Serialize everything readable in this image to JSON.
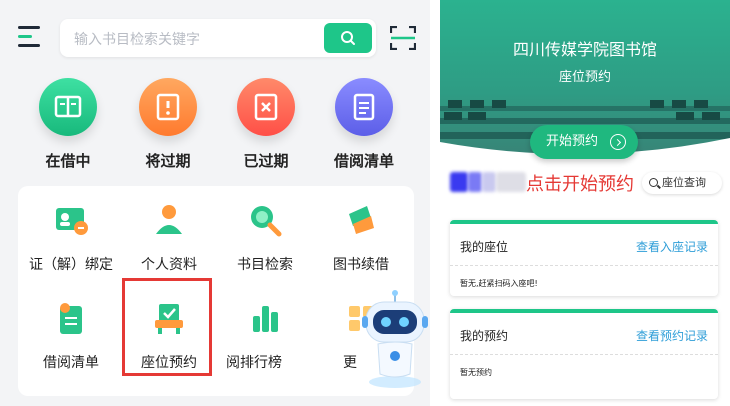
{
  "left": {
    "search": {
      "placeholder": "输入书目检索关键字"
    },
    "quick_actions": [
      {
        "label": "在借中",
        "icon": "book-icon",
        "color": "#1ec689"
      },
      {
        "label": "将过期",
        "icon": "clock-book-icon",
        "color": "#ff8a3d"
      },
      {
        "label": "已过期",
        "icon": "expired-book-icon",
        "color": "#ff5a4f"
      },
      {
        "label": "借阅清单",
        "icon": "list-icon",
        "color": "#6a6cf0"
      }
    ],
    "grid_items": [
      {
        "label": "证（解）绑定",
        "icon": "id-card-icon"
      },
      {
        "label": "个人资料",
        "icon": "person-icon"
      },
      {
        "label": "书目检索",
        "icon": "search-icon"
      },
      {
        "label": "图书续借",
        "icon": "renew-icon"
      },
      {
        "label": "借阅清单",
        "icon": "reading-list-icon"
      },
      {
        "label": "座位预约",
        "icon": "seat-icon"
      },
      {
        "label": "借阅排行榜",
        "display_label": "阅排行榜",
        "icon": "ranking-icon"
      },
      {
        "label": "更多",
        "display_label": "更",
        "icon": "more-icon"
      }
    ],
    "mascot": {
      "icon": "robot-mascot-icon"
    }
  },
  "right": {
    "title": "四川传媒学院图书馆",
    "subtitle": "座位预约",
    "start_button": "开始预约",
    "hint": "点击开始预约",
    "seat_query": "座位查询",
    "cards": [
      {
        "title": "我的座位",
        "link": "查看入座记录",
        "tip": "暂无,赶紧扫码入座吧!"
      },
      {
        "title": "我的预约",
        "link": "查看预约记录",
        "tip": "暂无预约"
      }
    ]
  },
  "colors": {
    "accent": "#1ec689",
    "highlight": "#e53935",
    "link": "#2f9ed8"
  }
}
